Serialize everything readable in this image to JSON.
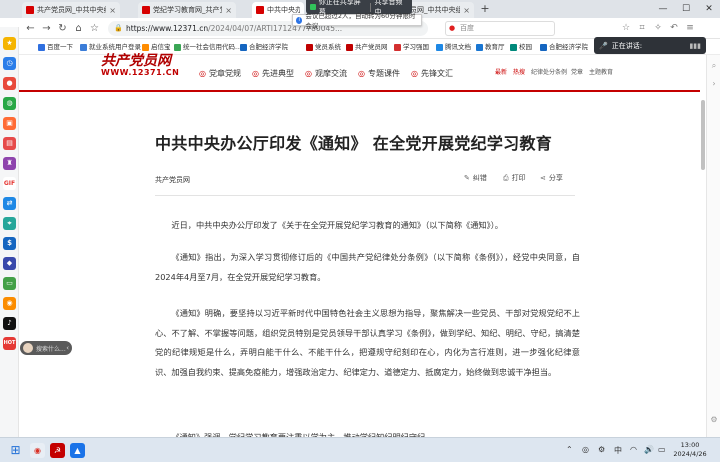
{
  "browser": {
    "tabs": [
      {
        "label": "共产党员网_中共中央组织部"
      },
      {
        "label": "党纪学习教育网_共产党员网"
      },
      {
        "label": "中共中央办公厅印发"
      },
      {
        "label": "共产党员网_中共中央组织部"
      }
    ],
    "url_host": "https://www.12371.cn",
    "url_path": "/2024/04/07/ARTI1712477780045...",
    "search_placeholder": "百度",
    "bookmarks": [
      {
        "label": "百度一下",
        "color": "#2f6fe0"
      },
      {
        "label": "就业系统用户登录",
        "color": "#3b7dd8"
      },
      {
        "label": "启信宝",
        "color": "#ff8c00"
      },
      {
        "label": "统一社会信用代码...",
        "color": "#3aa655"
      },
      {
        "label": "合肥经济学院",
        "color": "#1565c0"
      },
      {
        "label": "党员系统",
        "color": "#c00000"
      },
      {
        "label": "共产党员网",
        "color": "#c00000"
      },
      {
        "label": "学习强国",
        "color": "#d32f2f"
      },
      {
        "label": "腾讯文档",
        "color": "#1e88e5"
      },
      {
        "label": "教育厅",
        "color": "#1976d2"
      },
      {
        "label": "校园",
        "color": "#00897b"
      },
      {
        "label": "合肥经济学院",
        "color": "#1565c0"
      }
    ]
  },
  "share": {
    "status": "你正在共享屏幕",
    "action": "共享音频中",
    "notice": "会议已超过2人，自动转为60分钟限时会议"
  },
  "speaking": {
    "label": "正在讲话:"
  },
  "site": {
    "logo_text": "共产党员网",
    "logo_url": "WWW.12371.CN",
    "nav": [
      {
        "label": "党章党规"
      },
      {
        "label": "先进典型"
      },
      {
        "label": "观摩交流"
      },
      {
        "label": "专题课件"
      },
      {
        "label": "先锋文汇"
      }
    ],
    "right_links": [
      {
        "label": "最新"
      },
      {
        "label": "热搜"
      },
      {
        "label": "纪律处分条例"
      },
      {
        "label": "党章"
      },
      {
        "label": "主题教育"
      }
    ]
  },
  "article": {
    "title": "中共中央办公厅印发《通知》 在全党开展党纪学习教育",
    "source": "共产党员网",
    "tools": {
      "correction": "纠错",
      "print": "打印",
      "share": "分享"
    },
    "paragraphs": [
      "近日，中共中央办公厅印发了《关于在全党开展党纪学习教育的通知》（以下简称《通知》）。",
      "《通知》指出，为深入学习贯彻修订后的《中国共产党纪律处分条例》（以下简称《条例》），经党中央同意，自2024年4月至7月，在全党开展党纪学习教育。",
      "《通知》明确，要坚持以习近平新时代中国特色社会主义思想为指导，聚焦解决一些党员、干部对党规党纪不上心、不了解、不掌握等问题，组织党员特别是党员领导干部认真学习《条例》，做到学纪、知纪、明纪、守纪，搞清楚党的纪律规矩是什么，弄明白能干什么、不能干什么，把遵规守纪刻印在心，内化为言行准则，进一步强化纪律意识、加强自我约束、提高免疫能力，增强政治定力、纪律定力、道德定力、抵腐定力，始终做到忠诚干净担当。",
      "《通知》强调，党纪学习教育要注重以学为主，推动学纪知纪明纪守纪。"
    ]
  },
  "floating_search": {
    "placeholder": "搜索什么..."
  },
  "taskbar": {
    "lang": "中",
    "time": "13:00",
    "date": "2024/4/26"
  }
}
